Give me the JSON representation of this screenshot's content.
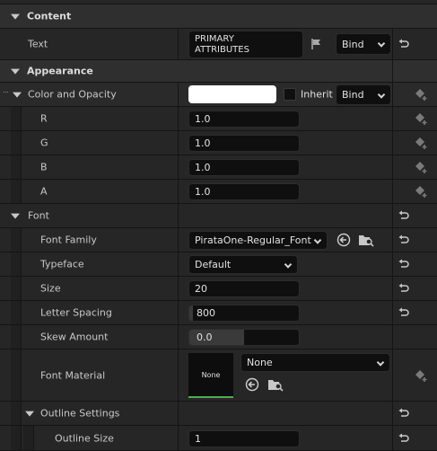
{
  "content": {
    "section_title": "Content",
    "text_label": "Text",
    "text_value": "PRIMARY\nATTRIBUTES",
    "bind_label": "Bind"
  },
  "appearance": {
    "section_title": "Appearance",
    "color_label": "Color and Opacity",
    "color_swatch": "#ffffff",
    "inherit_label": "Inherit",
    "bind_label": "Bind",
    "channels": [
      {
        "label": "R",
        "value": "1.0"
      },
      {
        "label": "G",
        "value": "1.0"
      },
      {
        "label": "B",
        "value": "1.0"
      },
      {
        "label": "A",
        "value": "1.0"
      }
    ]
  },
  "font": {
    "section_title": "Font",
    "family_label": "Font Family",
    "family_value": "PirataOne-Regular_Font",
    "typeface_label": "Typeface",
    "typeface_value": "Default",
    "size_label": "Size",
    "size_value": "20",
    "spacing_label": "Letter Spacing",
    "spacing_value": "800",
    "skew_label": "Skew Amount",
    "skew_value": "0.0",
    "material_label": "Font Material",
    "material_thumb": "None",
    "material_value": "None",
    "outline_label": "Outline Settings",
    "outline_size_label": "Outline Size",
    "outline_size_value": "1"
  },
  "colors": {
    "accent_green": "#4caf50",
    "reset_icon": "#c8c8c8"
  }
}
